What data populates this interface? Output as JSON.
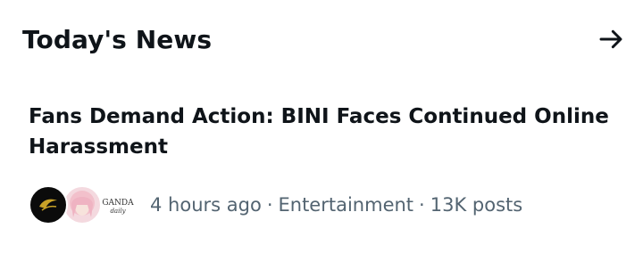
{
  "section": {
    "title": "Today's News",
    "arrow_icon": "arrow-right-icon"
  },
  "story": {
    "headline": "Fans Demand Action: BINI Faces Continued Online Harassment",
    "time": "4 hours ago",
    "separator": "·",
    "category": "Entertainment",
    "posts": "13K posts",
    "avatars": [
      {
        "icon": "publisher-logo-avatar",
        "color": "#0b0b0b",
        "accent": "#c9a227"
      },
      {
        "icon": "pink-hair-person-avatar",
        "color": "#f4d9df"
      },
      {
        "icon": "ganda-daily-logo-avatar",
        "text": "GANDA",
        "subtext": "daily"
      }
    ]
  }
}
